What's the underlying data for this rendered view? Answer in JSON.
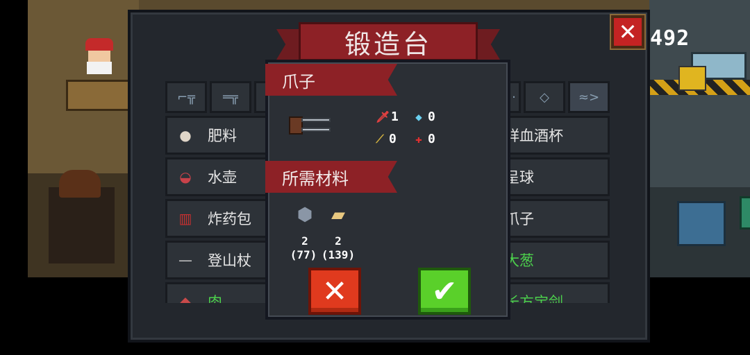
{
  "forge": {
    "title": "锻造台",
    "coin_count": "492",
    "close_label": "✕",
    "tabs": [
      {
        "icon": "pistol-icon",
        "glyph": "⌐╦"
      },
      {
        "icon": "rifle-icon",
        "glyph": "═╦"
      },
      {
        "icon": "partial-tab-icon",
        "glyph": ""
      },
      {
        "icon": "partial-tab-icon",
        "glyph": "·"
      },
      {
        "icon": "crosshair-icon",
        "glyph": "◇"
      },
      {
        "icon": "fish-icon",
        "glyph": "≈>"
      }
    ],
    "items_left": [
      {
        "name": "肥料",
        "icon": "fertilizer-bag-icon",
        "glyph": "●",
        "color": "#e0d6c8"
      },
      {
        "name": "水壶",
        "icon": "kettle-icon",
        "glyph": "◒",
        "color": "#c8424a"
      },
      {
        "name": "炸药包",
        "icon": "dynamite-icon",
        "glyph": "▥",
        "color": "#c83030"
      },
      {
        "name": "登山杖",
        "icon": "hiking-pole-icon",
        "glyph": "—",
        "color": "#c8c8c8"
      },
      {
        "name": "肉",
        "icon": "meat-icon",
        "glyph": "◆",
        "color": "#c84a4a"
      }
    ],
    "items_right": [
      {
        "name": "祥血酒杯",
        "green": false
      },
      {
        "name": "呈球",
        "green": false
      },
      {
        "name": "爪子",
        "green": false
      },
      {
        "name": "大葱",
        "green": true
      },
      {
        "name": "长方宝剑",
        "green": true
      }
    ]
  },
  "popup": {
    "item_title": "爪子",
    "materials_title": "所需材料",
    "stats": {
      "attack": "1",
      "diamond": "0",
      "crit": "0",
      "accuracy": "0"
    },
    "materials": [
      {
        "icon": "ore-icon",
        "required": "2",
        "owned": "(77)"
      },
      {
        "icon": "wood-icon",
        "required": "2",
        "owned": "(139)"
      }
    ],
    "cancel_label": "✕",
    "confirm_label": "✔"
  },
  "colors": {
    "accent_red": "#8d2126",
    "cancel_red": "#e03a1e",
    "confirm_green": "#5ad02a",
    "panel_bg": "#23272d"
  }
}
